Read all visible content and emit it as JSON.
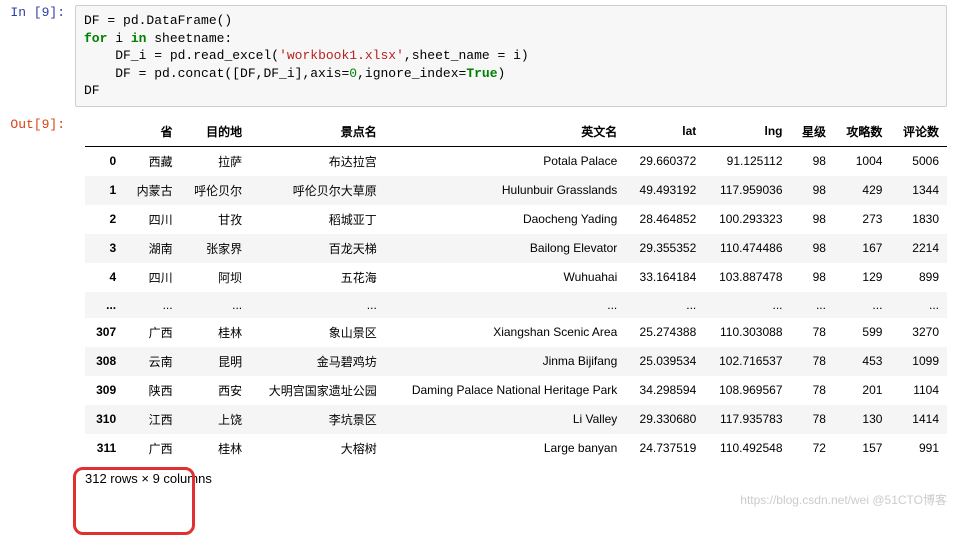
{
  "in_prompt": "In  [9]:",
  "out_prompt": "Out[9]:",
  "code": {
    "l1a": "DF ",
    "l1b": "=",
    "l1c": " pd.DataFrame()",
    "l2a": "for",
    "l2b": " i ",
    "l2c": "in",
    "l2d": " sheetname:",
    "l3a": "    DF_i ",
    "l3b": "=",
    "l3c": " pd.read_excel(",
    "l3d": "'workbook1.xlsx'",
    "l3e": ",sheet_name ",
    "l3f": "=",
    "l3g": " i)",
    "l4a": "    DF ",
    "l4b": "=",
    "l4c": " pd.concat([DF,DF_i],axis",
    "l4d": "=",
    "l4e": "0",
    "l4f": ",ignore_index",
    "l4g": "=",
    "l4h": "True",
    "l4i": ")",
    "l5": "DF"
  },
  "columns": [
    "省",
    "目的地",
    "景点名",
    "英文名",
    "lat",
    "lng",
    "星级",
    "攻略数",
    "评论数"
  ],
  "data_rows": [
    {
      "idx": "0",
      "省": "西藏",
      "目的地": "拉萨",
      "景点名": "布达拉宫",
      "英文名": "Potala Palace",
      "lat": "29.660372",
      "lng": "91.125112",
      "星级": "98",
      "攻略数": "1004",
      "评论数": "5006"
    },
    {
      "idx": "1",
      "省": "内蒙古",
      "目的地": "呼伦贝尔",
      "景点名": "呼伦贝尔大草原",
      "英文名": "Hulunbuir Grasslands",
      "lat": "49.493192",
      "lng": "117.959036",
      "星级": "98",
      "攻略数": "429",
      "评论数": "1344"
    },
    {
      "idx": "2",
      "省": "四川",
      "目的地": "甘孜",
      "景点名": "稻城亚丁",
      "英文名": "Daocheng Yading",
      "lat": "28.464852",
      "lng": "100.293323",
      "星级": "98",
      "攻略数": "273",
      "评论数": "1830"
    },
    {
      "idx": "3",
      "省": "湖南",
      "目的地": "张家界",
      "景点名": "百龙天梯",
      "英文名": "Bailong Elevator",
      "lat": "29.355352",
      "lng": "110.474486",
      "星级": "98",
      "攻略数": "167",
      "评论数": "2214"
    },
    {
      "idx": "4",
      "省": "四川",
      "目的地": "阿坝",
      "景点名": "五花海",
      "英文名": "Wuhuahai",
      "lat": "33.164184",
      "lng": "103.887478",
      "星级": "98",
      "攻略数": "129",
      "评论数": "899"
    }
  ],
  "ellipsis": "...",
  "data_rows2": [
    {
      "idx": "307",
      "省": "广西",
      "目的地": "桂林",
      "景点名": "象山景区",
      "英文名": "Xiangshan Scenic Area",
      "lat": "25.274388",
      "lng": "110.303088",
      "星级": "78",
      "攻略数": "599",
      "评论数": "3270"
    },
    {
      "idx": "308",
      "省": "云南",
      "目的地": "昆明",
      "景点名": "金马碧鸡坊",
      "英文名": "Jinma Bijifang",
      "lat": "25.039534",
      "lng": "102.716537",
      "星级": "78",
      "攻略数": "453",
      "评论数": "1099"
    },
    {
      "idx": "309",
      "省": "陕西",
      "目的地": "西安",
      "景点名": "大明宫国家遗址公园",
      "英文名": "Daming Palace National Heritage Park",
      "lat": "34.298594",
      "lng": "108.969567",
      "星级": "78",
      "攻略数": "201",
      "评论数": "1104"
    },
    {
      "idx": "310",
      "省": "江西",
      "目的地": "上饶",
      "景点名": "李坑景区",
      "英文名": "Li Valley",
      "lat": "29.330680",
      "lng": "117.935783",
      "星级": "78",
      "攻略数": "130",
      "评论数": "1414"
    },
    {
      "idx": "311",
      "省": "广西",
      "目的地": "桂林",
      "景点名": "大榕树",
      "英文名": "Large banyan",
      "lat": "24.737519",
      "lng": "110.492548",
      "星级": "72",
      "攻略数": "157",
      "评论数": "991"
    }
  ],
  "shape_text": "312 rows × 9 columns",
  "watermark": "https://blog.csdn.net/wei  @51CTO博客"
}
